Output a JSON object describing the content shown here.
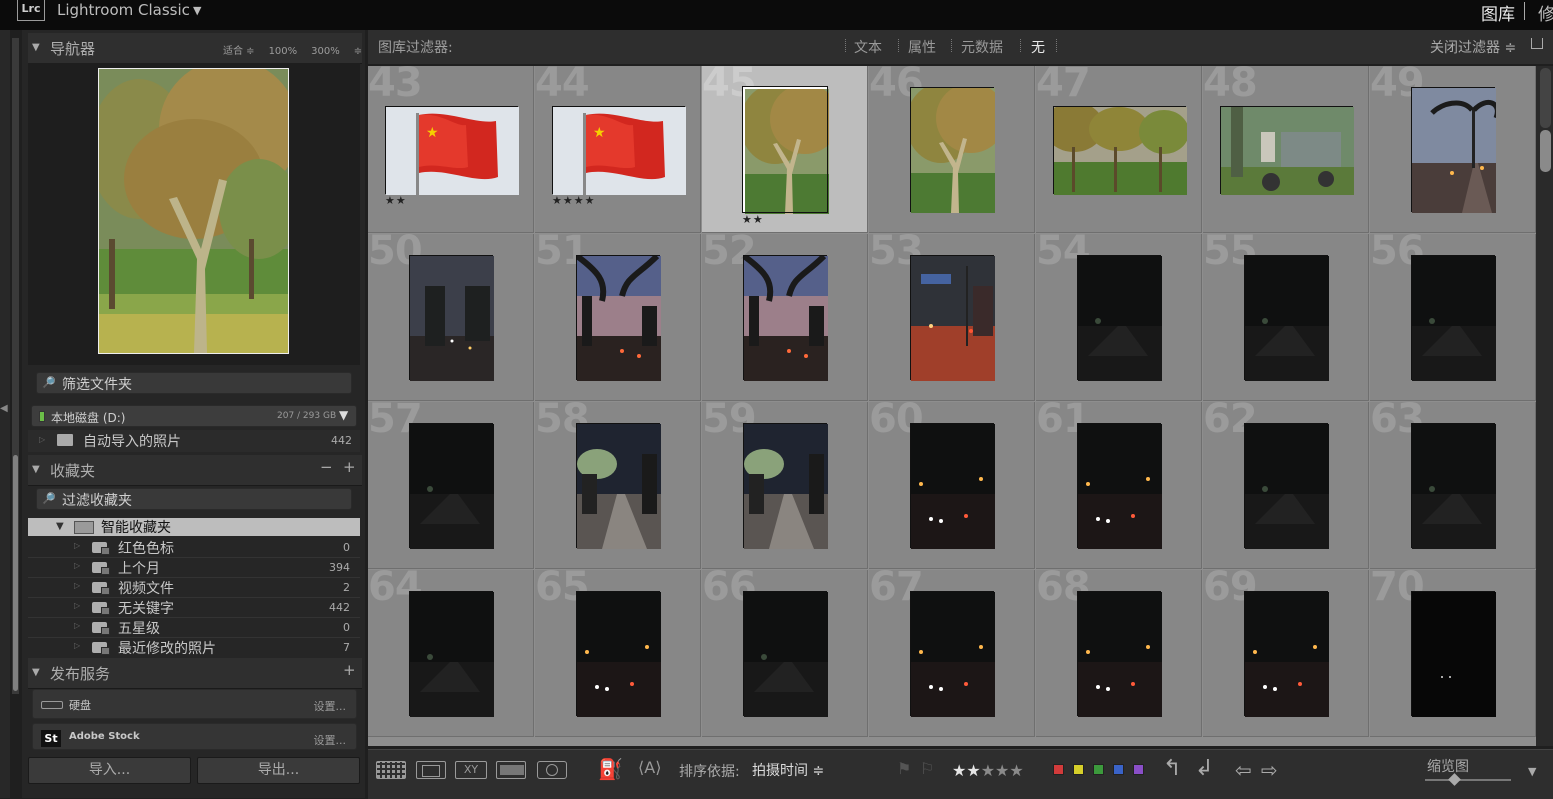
{
  "titlebar": {
    "logo": "Lrc",
    "app_title": "Lightroom Classic",
    "menu_arrow": "▼",
    "module_library": "图库",
    "module_develop": "修"
  },
  "navigator": {
    "title": "导航器",
    "options": [
      "适合 ≑",
      "100%",
      "300%",
      "≑"
    ]
  },
  "folders": {
    "search_placeholder": "筛选文件夹",
    "disk_name": "本地磁盘 (D:)",
    "disk_size": "207 / 293 GB",
    "folder_name": "自动导入的照片",
    "folder_count": "442"
  },
  "collections": {
    "title": "收藏夹",
    "minus": "−",
    "plus": "+",
    "search_placeholder": "过滤收藏夹",
    "smart_label": "智能收藏夹",
    "items": [
      {
        "label": "红色色标",
        "count": "0"
      },
      {
        "label": "上个月",
        "count": "394"
      },
      {
        "label": "视频文件",
        "count": "2"
      },
      {
        "label": "无关键字",
        "count": "442"
      },
      {
        "label": "五星级",
        "count": "0"
      },
      {
        "label": "最近修改的照片",
        "count": "7"
      }
    ]
  },
  "publish": {
    "title": "发布服务",
    "plus": "+",
    "services": [
      {
        "label": "硬盘",
        "action": "设置..."
      },
      {
        "label": "Adobe Stock",
        "action": "设置..."
      }
    ]
  },
  "bottom_buttons": {
    "import": "导入...",
    "export": "导出..."
  },
  "filter_bar": {
    "title": "图库过滤器:",
    "items": [
      "文本",
      "属性",
      "元数据",
      "无"
    ],
    "close": "关闭过滤器 ≑"
  },
  "grid": {
    "cells": [
      {
        "num": "43",
        "stars": "★★",
        "kind": "flag"
      },
      {
        "num": "44",
        "stars": "★★★★",
        "kind": "flag"
      },
      {
        "num": "45",
        "stars": "★★",
        "kind": "tree",
        "selected": true
      },
      {
        "num": "46",
        "stars": "",
        "kind": "tree"
      },
      {
        "num": "47",
        "stars": "",
        "kind": "trees-wide"
      },
      {
        "num": "48",
        "stars": "",
        "kind": "tricycle"
      },
      {
        "num": "49",
        "stars": "",
        "kind": "road-dusk"
      },
      {
        "num": "50",
        "stars": "",
        "kind": "night-blue"
      },
      {
        "num": "51",
        "stars": "",
        "kind": "sunset"
      },
      {
        "num": "52",
        "stars": "",
        "kind": "sunset"
      },
      {
        "num": "53",
        "stars": "",
        "kind": "red-road"
      },
      {
        "num": "54",
        "stars": "",
        "kind": "dark"
      },
      {
        "num": "55",
        "stars": "",
        "kind": "dark"
      },
      {
        "num": "56",
        "stars": "",
        "kind": "dark"
      },
      {
        "num": "57",
        "stars": "",
        "kind": "dark"
      },
      {
        "num": "58",
        "stars": "",
        "kind": "lit-road"
      },
      {
        "num": "59",
        "stars": "",
        "kind": "lit-road"
      },
      {
        "num": "60",
        "stars": "",
        "kind": "dark-lights"
      },
      {
        "num": "61",
        "stars": "",
        "kind": "dark-lights"
      },
      {
        "num": "62",
        "stars": "",
        "kind": "dark"
      },
      {
        "num": "63",
        "stars": "",
        "kind": "dark"
      },
      {
        "num": "64",
        "stars": "",
        "kind": "dark"
      },
      {
        "num": "65",
        "stars": "",
        "kind": "dark-lights"
      },
      {
        "num": "66",
        "stars": "",
        "kind": "dark"
      },
      {
        "num": "67",
        "stars": "",
        "kind": "dark-lights"
      },
      {
        "num": "68",
        "stars": "",
        "kind": "dark-lights"
      },
      {
        "num": "69",
        "stars": "",
        "kind": "dark-lights"
      },
      {
        "num": "70",
        "stars": "",
        "kind": "black"
      }
    ]
  },
  "toolbar": {
    "xy_label": "XY",
    "sort_label": "排序依据:",
    "sort_value": "拍摄时间 ≑",
    "stars": "★★★★★",
    "rating": 2,
    "colors": [
      "#d23b3b",
      "#d6cf2a",
      "#3c9a3c",
      "#3a63c8",
      "#8a4fc8"
    ],
    "thumb_label": "缩览图",
    "menu_arrow": "▼"
  }
}
